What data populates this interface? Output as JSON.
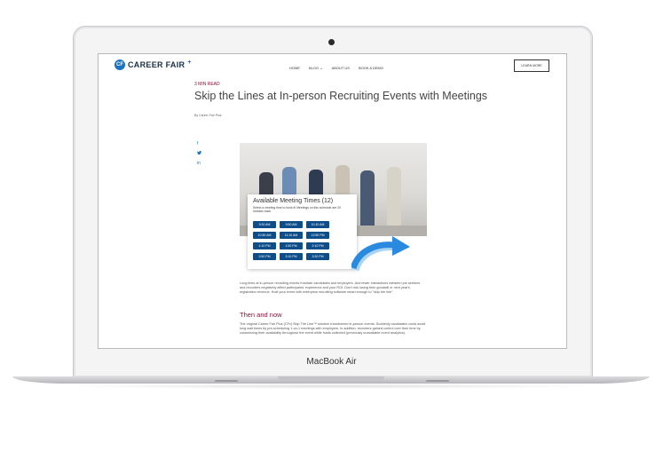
{
  "device": {
    "label": "MacBook Air"
  },
  "site": {
    "logo": {
      "mark": "CF",
      "text": "CAREER FAIR",
      "plus": "+"
    },
    "nav": [
      "HOME",
      "BLOG ⌄",
      "ABOUT US",
      "BOOK A DEMO"
    ],
    "cta": "LEARN MORE"
  },
  "article": {
    "read_time": "3 MIN READ",
    "title": "Skip the Lines at In-person Recruiting Events with Meetings",
    "byline": "By Career Fair Plus",
    "social": [
      "f",
      "t",
      "in"
    ],
    "widget": {
      "title": "Available Meeting Times (12)",
      "description": "Select a meeting time to book it! Meetings on this schedule are 20 minutes each.",
      "slots": [
        "9:30 AM",
        "9:50 AM",
        "10:10 AM",
        "10:50 AM",
        "11:10 AM",
        "12:50 PM",
        "1:10 PM",
        "1:50 PM",
        "2:10 PM",
        "2:50 PM",
        "3:10 PM",
        "3:30 PM"
      ]
    },
    "intro": "Long lines at in-person recruiting events frustrate candidates and employers. And fewer interactions between job seekers and recruiters negatively affect participants' experience and your ROI. Don't risk losing their goodwill or next year's registration revenue. Host your event with enterprise recruiting software smart enough to \"skip the line\".",
    "subheading": "Then and now",
    "body": "The original Career Fair Plus (CFx) Skip The Line™ solution transformed in-person events. Suddenly candidates could avoid long wait times by pre-scheduling 1-on-1 meetings with employers. In addition, recruiters gained control over their time by customizing their availability throughout the event while hosts collected (previously unavailable event analytics)."
  },
  "colors": {
    "brand_blue": "#1a72c4",
    "accent": "#8a1538",
    "slot_bg": "#0d4d8a"
  }
}
